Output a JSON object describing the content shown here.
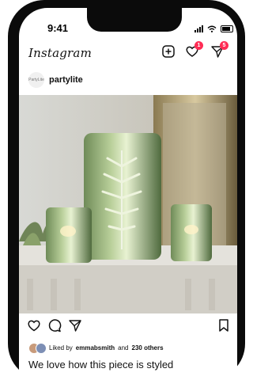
{
  "status_bar": {
    "time": "9:41"
  },
  "header": {
    "app_name": "Instagram",
    "notification_badges": {
      "activity": "1",
      "messages": "5"
    }
  },
  "post": {
    "username": "partylite",
    "avatar_label": "PartyLite",
    "likes": {
      "prefix": "Liked by",
      "user": "emmabsmith",
      "and": "and",
      "count": "230 others"
    },
    "caption": "We love how this piece is styled"
  },
  "colors": {
    "badge": "#ff2d55",
    "text": "#111111"
  },
  "icons": [
    "new-post-icon",
    "heart-icon",
    "direct-message-icon",
    "like-icon",
    "comment-icon",
    "share-icon",
    "bookmark-icon"
  ]
}
